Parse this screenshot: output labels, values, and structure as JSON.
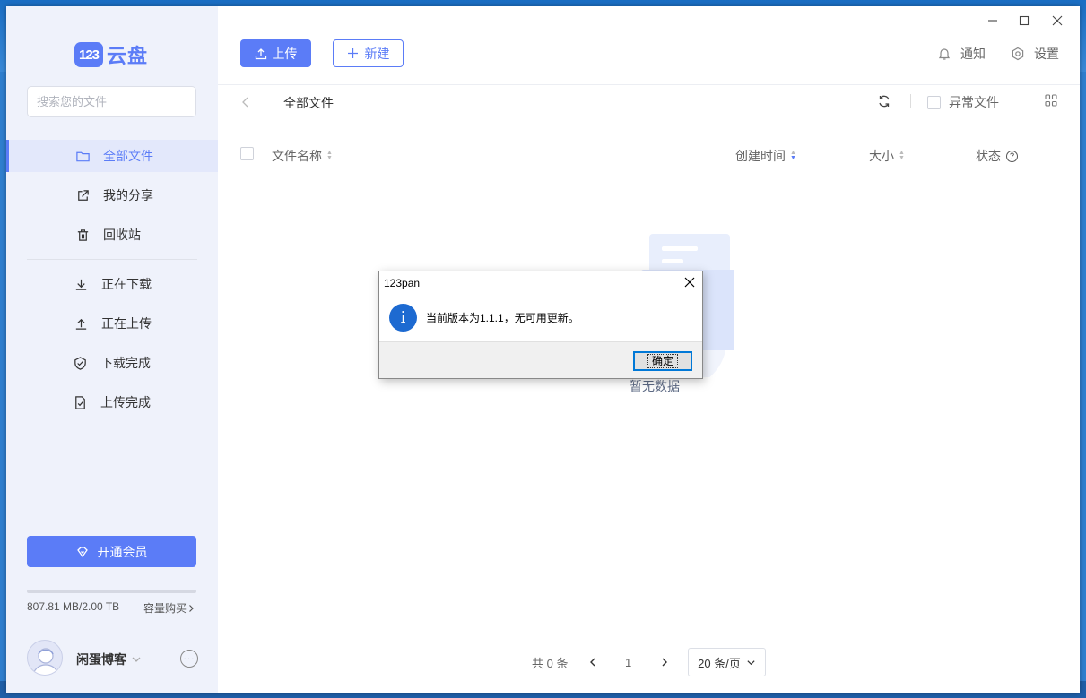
{
  "app": {
    "logo_badge": "123",
    "logo_text": "云盘"
  },
  "sidebar": {
    "search_placeholder": "搜索您的文件",
    "items": [
      {
        "label": "全部文件",
        "icon": "folder-icon"
      },
      {
        "label": "我的分享",
        "icon": "share-icon"
      },
      {
        "label": "回收站",
        "icon": "trash-icon"
      },
      {
        "label": "正在下载",
        "icon": "download-icon"
      },
      {
        "label": "正在上传",
        "icon": "upload-icon"
      },
      {
        "label": "下载完成",
        "icon": "check-circle-icon"
      },
      {
        "label": "上传完成",
        "icon": "file-check-icon"
      }
    ],
    "vip_label": "开通会员",
    "storage_text": "807.81 MB/2.00 TB",
    "storage_used_fraction": 0.0004,
    "buy_label": "容量购买",
    "username": "闲蛋博客"
  },
  "toolbar": {
    "upload_label": "上传",
    "new_label": "新建",
    "notify_label": "通知",
    "settings_label": "设置"
  },
  "breadcrumb": {
    "current": "全部文件",
    "abnormal_label": "异常文件"
  },
  "table": {
    "columns": [
      "文件名称",
      "创建时间",
      "大小",
      "状态"
    ],
    "empty_text": "暂无数据"
  },
  "pagination": {
    "total_text": "共 0 条",
    "current_page": "1",
    "page_size": "20 条/页"
  },
  "dialog": {
    "title": "123pan",
    "message": "当前版本为1.1.1，无可用更新。",
    "ok_label": "确定",
    "icon_glyph": "i"
  },
  "colors": {
    "accent": "#5b7cf7",
    "sidebar_bg": "#eff2fb",
    "dialog_icon": "#1d6ad1"
  }
}
